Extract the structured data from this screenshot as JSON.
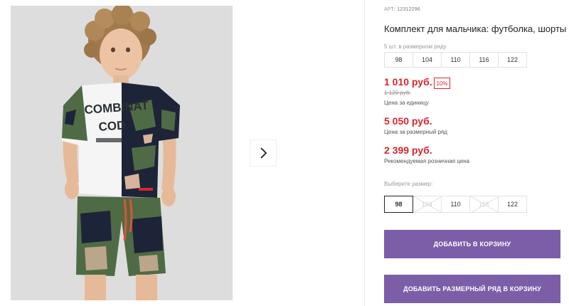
{
  "product": {
    "article_label": "АРТ:",
    "article": "12312296",
    "title": "Комплект для мальчика: футболка, шорты",
    "row_count_label": "5 шт. в размерном ряду",
    "row_sizes": [
      "98",
      "104",
      "110",
      "116",
      "122"
    ]
  },
  "prices": {
    "main": "1 010 руб.",
    "discount": "10%",
    "old": "1 120 руб.",
    "unit_label": "Цена за единицу",
    "row_price": "5 050 руб.",
    "row_label": "Цена за размерный ряд",
    "rrp": "2 399 руб.",
    "rrp_label": "Рекомендуемая розничная цена"
  },
  "size_picker": {
    "label": "Выберите размер:",
    "options": [
      {
        "label": "98",
        "state": "selected"
      },
      {
        "label": "104",
        "state": "disabled"
      },
      {
        "label": "110",
        "state": "available"
      },
      {
        "label": "116",
        "state": "disabled"
      },
      {
        "label": "122",
        "state": "available"
      }
    ]
  },
  "buttons": {
    "add_to_cart": "ДОБАВИТЬ В КОРЗИНУ",
    "add_row_to_cart": "ДОБАВИТЬ РАЗМЕРНЫЙ РЯД В КОРЗИНУ"
  },
  "shirt_print": {
    "line1": "COMBINAT",
    "line2": "COD"
  },
  "colors": {
    "accent": "#7c5ea8",
    "price": "#d8262b",
    "camo_green": "#4e6b46",
    "navy": "#1d2438"
  },
  "icons": {
    "next": "chevron-right-icon"
  }
}
